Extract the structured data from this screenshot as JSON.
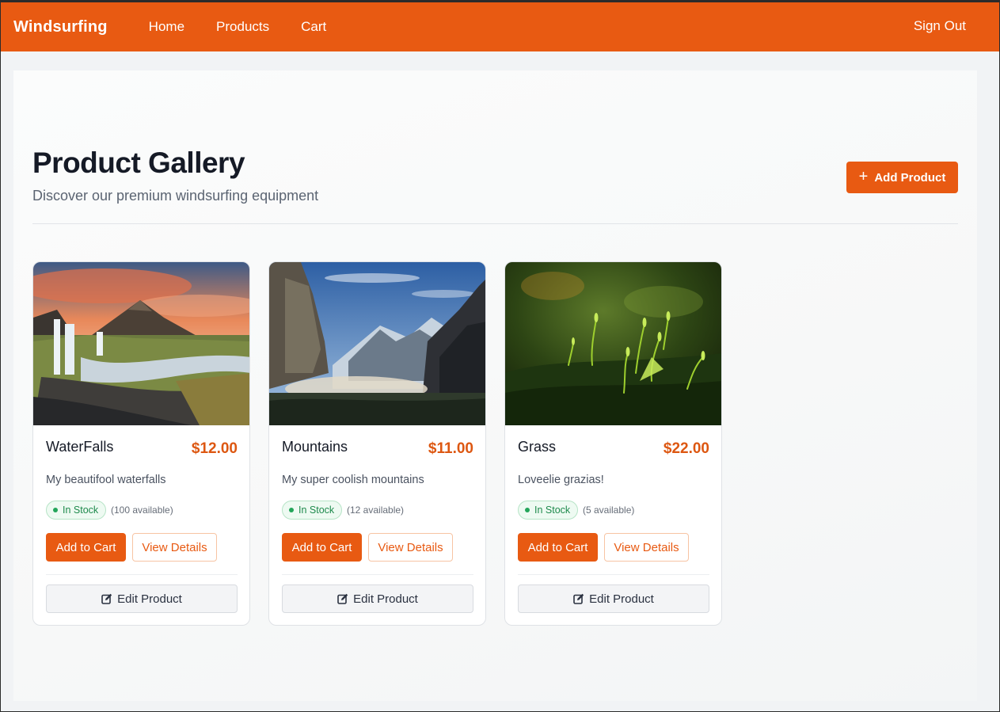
{
  "nav": {
    "brand": "Windsurfing",
    "links": [
      "Home",
      "Products",
      "Cart"
    ],
    "signout": "Sign Out",
    "accent_color": "#e85a12"
  },
  "header": {
    "title": "Product Gallery",
    "subtitle": "Discover our premium windsurfing equipment",
    "add_button": "Add Product",
    "add_icon": "plus-icon"
  },
  "products": [
    {
      "name": "WaterFalls",
      "price": "$12.00",
      "description": "My beautifool waterfalls",
      "stock_label": "In Stock",
      "available": "(100 available)",
      "add_to_cart": "Add to Cart",
      "view_details": "View Details",
      "edit": "Edit Product",
      "image": "waterfall-landscape"
    },
    {
      "name": "Mountains",
      "price": "$11.00",
      "description": "My super coolish mountains",
      "stock_label": "In Stock",
      "available": "(12 available)",
      "add_to_cart": "Add to Cart",
      "view_details": "View Details",
      "edit": "Edit Product",
      "image": "mountain-valley"
    },
    {
      "name": "Grass",
      "price": "$22.00",
      "description": "Loveelie grazias!",
      "stock_label": "In Stock",
      "available": "(5 available)",
      "add_to_cart": "Add to Cart",
      "view_details": "View Details",
      "edit": "Edit Product",
      "image": "moss-sprouts"
    }
  ]
}
